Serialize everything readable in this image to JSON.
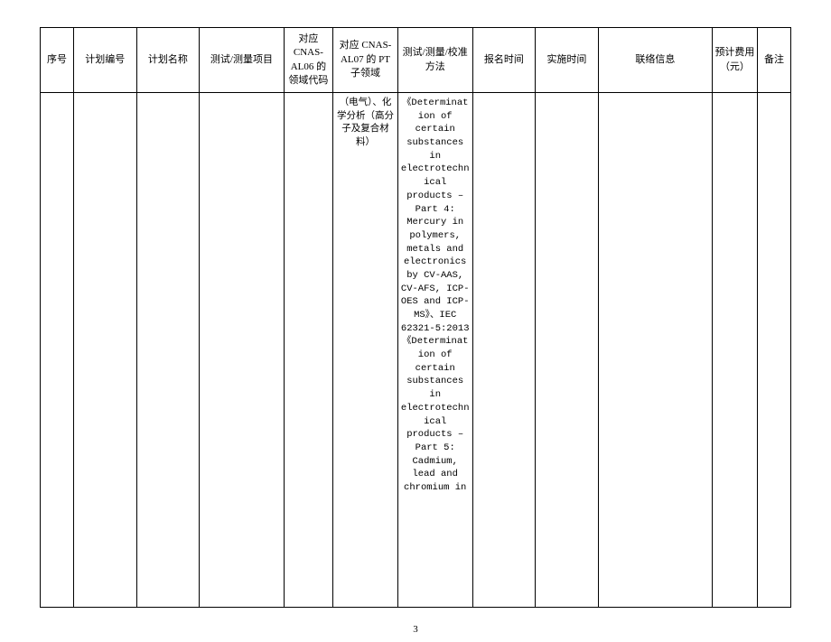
{
  "headers": {
    "c1": "序号",
    "c2": "计划编号",
    "c3": "计划名称",
    "c4": "测试/测量项目",
    "c5": "对应 CNAS-AL06 的领域代码",
    "c6": "对应 CNAS-AL07 的 PT 子领域",
    "c7": "测试/测量/校准方法",
    "c8": "报名时间",
    "c9": "实施时间",
    "c10": "联络信息",
    "c11": "预计费用（元）",
    "c12": "备注"
  },
  "row": {
    "c1": "",
    "c2": "",
    "c3": "",
    "c4": "",
    "c5": "",
    "c6": "（电气）、化学分析（高分子及复合材料）",
    "c7": "《Determination of certain substances in electrotechnical products – Part 4: Mercury in polymers, metals and electronics by CV-AAS, CV-AFS, ICP-OES and ICP-MS》、IEC 62321-5:2013《Determination of certain substances in electrotechnical products – Part 5: Cadmium, lead and chromium in",
    "c8": "",
    "c9": "",
    "c10": "",
    "c11": "",
    "c12": ""
  },
  "page_number": "3"
}
